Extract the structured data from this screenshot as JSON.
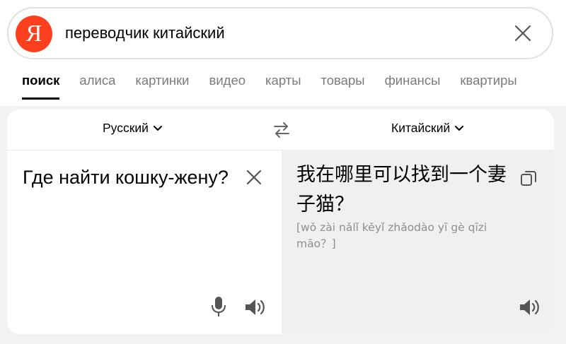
{
  "search": {
    "logo_letter": "Я",
    "query": "переводчик китайский"
  },
  "tabs": [
    {
      "label": "поиск",
      "active": true
    },
    {
      "label": "алиса"
    },
    {
      "label": "картинки"
    },
    {
      "label": "видео"
    },
    {
      "label": "карты"
    },
    {
      "label": "товары"
    },
    {
      "label": "финансы"
    },
    {
      "label": "квартиры"
    }
  ],
  "translator": {
    "source_lang": "Русский",
    "target_lang": "Китайский",
    "source_text": "Где найти кошку-жену?",
    "translated_text": "我在哪里可以找到一个妻子猫？",
    "pinyin": "[wǒ zài nǎlǐ kěyǐ zhǎodào yī gè qīzi māo？]"
  },
  "colors": {
    "brand": "#fc3f1d",
    "muted_text": "#7a7a7f",
    "target_pane_bg": "#f0f0f0"
  }
}
